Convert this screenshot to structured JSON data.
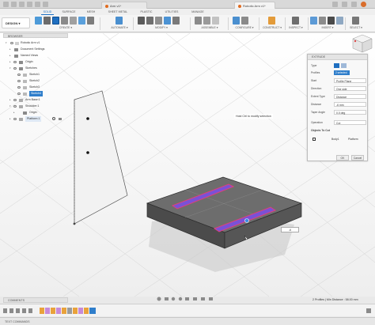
{
  "window": {
    "inactive_tab": "Arm v1*",
    "active_tab": "Robotic Arm v1*"
  },
  "workspace_tabs": [
    "SOLID",
    "SURFACE",
    "MESH",
    "SHEET METAL",
    "PLASTIC",
    "UTILITIES",
    "MANAGE"
  ],
  "design_button": "DESIGN ▾",
  "toolbar_groups": [
    "CREATE ▾",
    "AUTOMATE ▾",
    "MODIFY ▾",
    "ASSEMBLE ▾",
    "CONFIGURE ▾",
    "CONSTRUCT ▾",
    "INSPECT ▾",
    "INSERT ▾",
    "SELECT ▾"
  ],
  "browser": {
    "header": "BROWSER",
    "items": [
      {
        "label": "Robotic Arm v1",
        "selected": false
      },
      {
        "label": "Document Settings",
        "selected": false
      },
      {
        "label": "Named Views",
        "selected": false
      },
      {
        "label": "Origin",
        "selected": false
      },
      {
        "label": "Sketches",
        "selected": false
      },
      {
        "label": "Sketch1",
        "selected": false
      },
      {
        "label": "Sketch2",
        "selected": false
      },
      {
        "label": "Sketch3",
        "selected": false
      },
      {
        "label": "Sketch4",
        "selected": true
      },
      {
        "label": "Arm Base:1",
        "selected": false
      },
      {
        "label": "Shoulder:1",
        "selected": false
      },
      {
        "label": "Origin",
        "selected": false
      },
      {
        "label": "Platform:1",
        "selected": false
      }
    ]
  },
  "hint_text": "Hold Ctrl to modify selection",
  "extrude": {
    "title": "EXTRUDE",
    "rows": [
      {
        "key": "Type",
        "value": ""
      },
      {
        "key": "Profiles",
        "value": "2 selected"
      },
      {
        "key": "Start",
        "value": "Profile Plane"
      },
      {
        "key": "Direction",
        "value": "One side"
      },
      {
        "key": "Extent Type",
        "value": "Distance"
      },
      {
        "key": "Distance",
        "value": "-6 mm"
      },
      {
        "key": "Taper Angle",
        "value": "0.0 deg"
      },
      {
        "key": "Operation",
        "value": "Cut"
      }
    ],
    "objects_to_cut": "Objects To Cut",
    "cut_table": {
      "body": "Body1",
      "component": "Platform"
    },
    "ok": "OK",
    "cancel": "Cancel"
  },
  "distance_input": "-6",
  "comments_header": "COMMENTS",
  "status_text": "2 Profiles | Min Distance : 58.00 mm",
  "text_commands": "TEXT COMMANDS",
  "colors": {
    "accent": "#1a6fc2",
    "selection": "#2f7ecb",
    "platform_top": "#6d6d6d",
    "platform_side": "#4b4b4b",
    "slot_fill": "#7a51d6",
    "slot_edge": "#e0407a"
  }
}
